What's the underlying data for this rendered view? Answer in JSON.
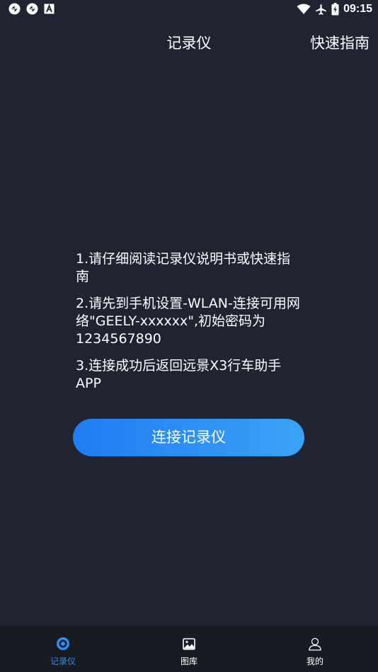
{
  "status_bar": {
    "time": "09:15",
    "left_icons": [
      "sync-icon",
      "sync-icon",
      "font-a-icon"
    ],
    "right_icons": [
      "wifi-icon",
      "airplane-icon",
      "battery-icon"
    ]
  },
  "header": {
    "title": "记录仪",
    "action": "快速指南"
  },
  "instructions": {
    "steps": [
      "1.请仔细阅读记录仪说明书或快速指南",
      "2.请先到手机设置-WLAN-连接可用网络\"GEELY-xxxxxx\",初始密码为1234567890",
      "3.连接成功后返回远景X3行车助手APP"
    ]
  },
  "connect_button": {
    "label": "连接记录仪",
    "color_start": "#1f7cf3",
    "color_end": "#3ba3f7"
  },
  "bottom_nav": {
    "items": [
      {
        "label": "记录仪",
        "icon": "eye-icon",
        "active": true
      },
      {
        "label": "图库",
        "icon": "gallery-icon",
        "active": false
      },
      {
        "label": "我的",
        "icon": "user-icon",
        "active": false
      }
    ],
    "active_color": "#2f8cf5"
  }
}
